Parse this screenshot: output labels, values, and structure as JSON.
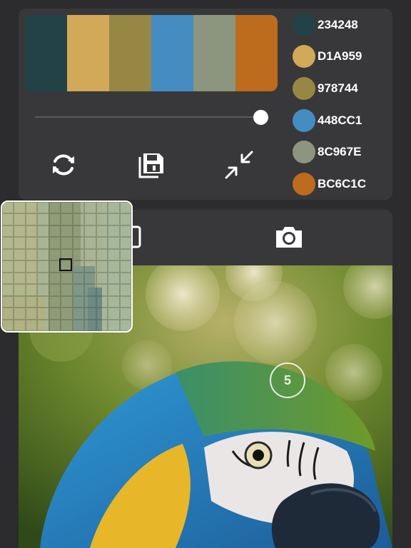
{
  "palette": {
    "colors": [
      {
        "hex": "234248",
        "color": "#234248"
      },
      {
        "hex": "D1A959",
        "color": "#D1A959"
      },
      {
        "hex": "978744",
        "color": "#978744"
      },
      {
        "hex": "448CC1",
        "color": "#448CC1"
      },
      {
        "hex": "8C967E",
        "color": "#8C967E"
      },
      {
        "hex": "BC6C1C",
        "color": "#BC6C1C"
      }
    ],
    "slider_value": 1.0
  },
  "toolbar": {
    "icons": [
      "refresh-icon",
      "save-icon",
      "collapse-icon"
    ]
  },
  "tabs": {
    "icons": [
      "image-icon",
      "camera-icon"
    ]
  },
  "brush": {
    "size_label": "5"
  }
}
